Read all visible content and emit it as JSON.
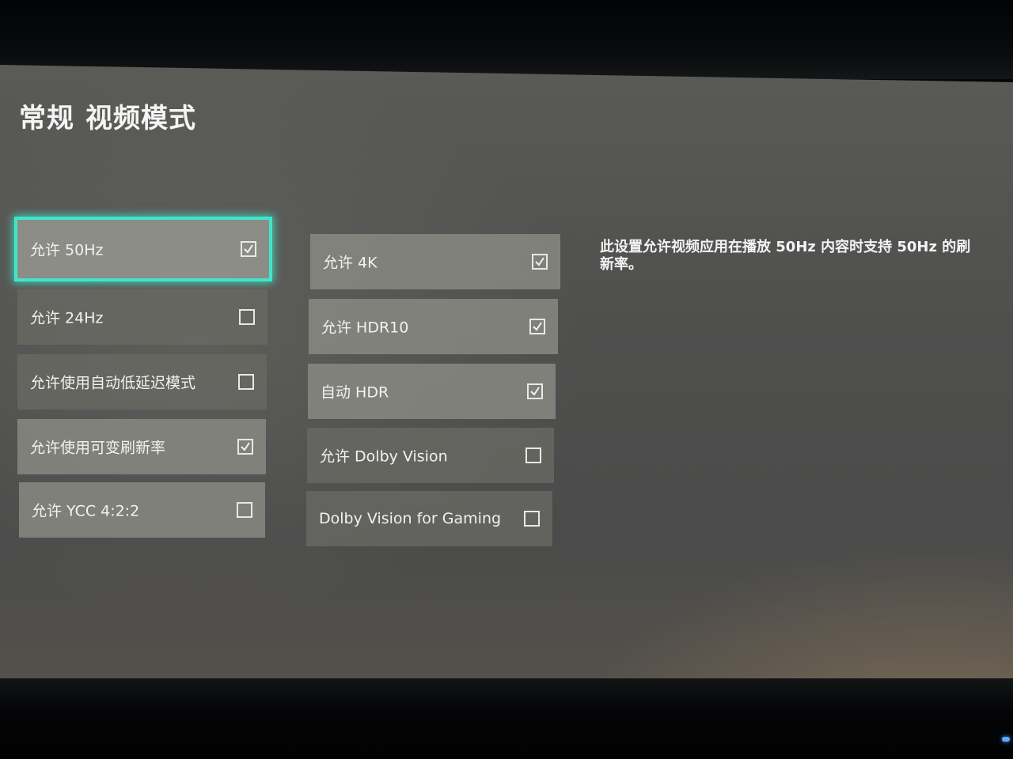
{
  "breadcrumb": {
    "section": "常规",
    "page": "视频模式"
  },
  "left_column": [
    {
      "label": "允许 50Hz",
      "checked": true,
      "focused": true
    },
    {
      "label": "允许 24Hz",
      "checked": false,
      "focused": false
    },
    {
      "label": "允许使用自动低延迟模式",
      "checked": false,
      "focused": false
    },
    {
      "label": "允许使用可变刷新率",
      "checked": true,
      "focused": false
    },
    {
      "label": "允许 YCC 4:2:2",
      "checked": false,
      "focused": false
    }
  ],
  "right_column": [
    {
      "label": "允许 4K",
      "checked": true,
      "focused": false
    },
    {
      "label": "允许 HDR10",
      "checked": true,
      "focused": false
    },
    {
      "label": "自动 HDR",
      "checked": true,
      "focused": false
    },
    {
      "label": "允许 Dolby Vision",
      "checked": false,
      "focused": false
    },
    {
      "label": "Dolby Vision for Gaming",
      "checked": false,
      "focused": false
    }
  ],
  "description": "此设置允许视频应用在播放 50Hz 内容时支持 50Hz 的刷新率。",
  "colors": {
    "focus_ring": "#3fe6c9",
    "text": "#f2f2f2",
    "tile": "#69696a"
  }
}
